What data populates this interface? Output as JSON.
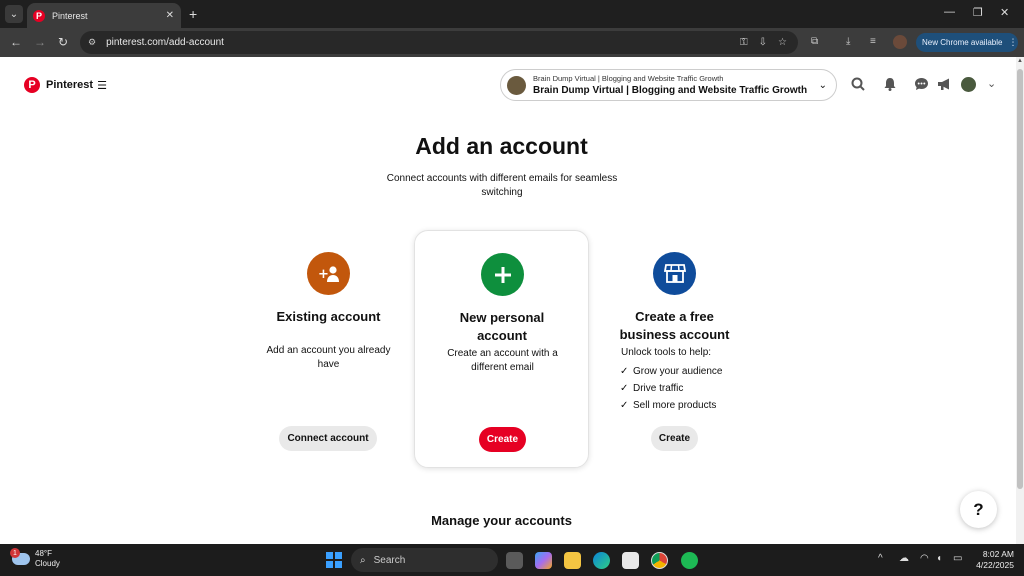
{
  "browser": {
    "tab_title": "Pinterest",
    "url": "pinterest.com/add-account",
    "new_chrome_label": "New Chrome available"
  },
  "header": {
    "brand": "Pinterest",
    "account_small": "Brain Dump Virtual | Blogging and Website Traffic Growth",
    "account_big": "Brain Dump Virtual | Blogging and Website Traffic Growth"
  },
  "main": {
    "title": "Add an account",
    "subtitle": "Connect accounts with different emails for seamless switching",
    "cards": [
      {
        "title": "Existing account",
        "desc": "Add an account you already have",
        "button": "Connect account",
        "color": "#c2570c",
        "icon": "add-person-icon"
      },
      {
        "title": "New personal account",
        "desc": "Create an account with a different email",
        "button": "Create",
        "color": "#0e8f3d",
        "icon": "plus-icon"
      },
      {
        "title": "Create a free business account",
        "desc": "Unlock tools to help:",
        "checks": [
          "Grow your audience",
          "Drive traffic",
          "Sell more products"
        ],
        "button": "Create",
        "color": "#0f4c9b",
        "icon": "storefront-icon"
      }
    ],
    "manage_heading": "Manage your accounts",
    "help_label": "?"
  },
  "taskbar": {
    "temp": "48°F",
    "weather": "Cloudy",
    "weather_badge": "1",
    "search_label": "Search",
    "time": "8:02 AM",
    "date": "4/22/2025"
  },
  "colors": {
    "pinterest_red": "#e60023",
    "chrome_dark": "#3c3c3c",
    "taskbar": "#1c1c1c"
  }
}
